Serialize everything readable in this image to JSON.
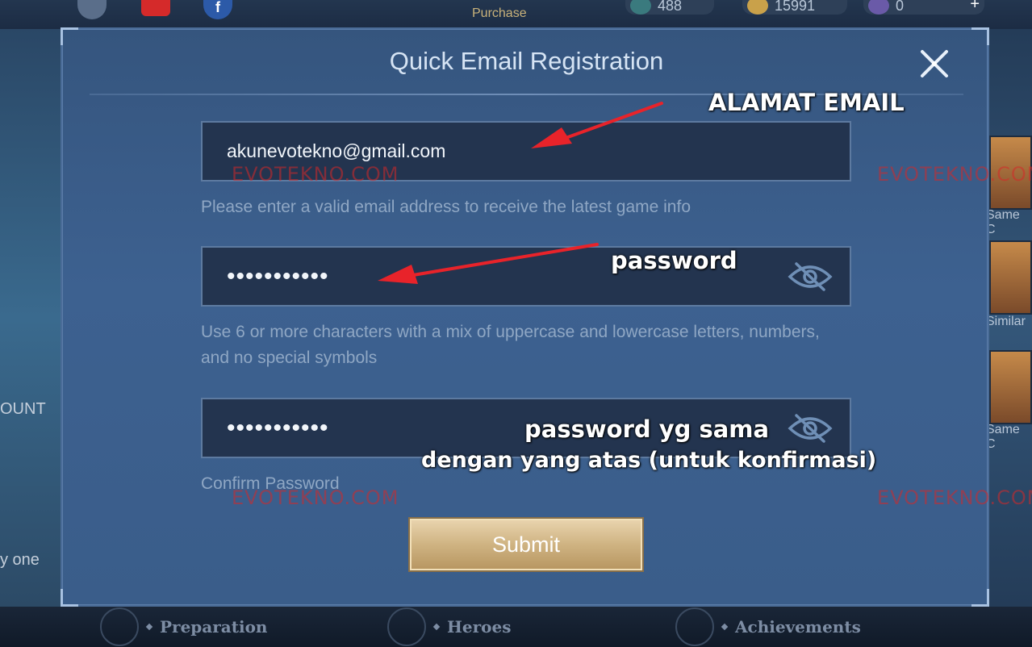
{
  "background": {
    "top_bar": {
      "purchase_label": "Purchase",
      "tickets": "488",
      "gold": "15991",
      "gems": "0",
      "plus": "+"
    },
    "left_panel": {
      "count_label": "OUNT",
      "one_label": "y one"
    },
    "right_panel": {
      "labels": [
        "Same C",
        "Similar",
        "Same C"
      ]
    },
    "bottom_nav": [
      "Preparation",
      "Heroes",
      "Achievements"
    ]
  },
  "modal": {
    "title": "Quick Email Registration",
    "email": {
      "value": "akunevotekno@gmail.com",
      "hint": "Please enter a valid email address to receive the latest game info"
    },
    "password": {
      "value": "•••••••••••",
      "hint": "Use 6 or more characters with a mix of uppercase and lowercase letters, numbers, and no special symbols"
    },
    "confirm": {
      "value": "•••••••••••",
      "hint": "Confirm Password"
    },
    "submit_label": "Submit"
  },
  "annotations": {
    "email": "ALAMAT EMAIL",
    "password": "password",
    "confirm_line1": "password yg sama",
    "confirm_line2": "dengan yang atas (untuk konfirmasi)"
  },
  "watermark": "EVOTEKNO.COM",
  "colors": {
    "annotation_arrow": "#e8232a",
    "submit_gold": "#cfb382",
    "field_bg": "#23344f"
  },
  "icons": [
    "close-icon",
    "eye-off-icon"
  ]
}
